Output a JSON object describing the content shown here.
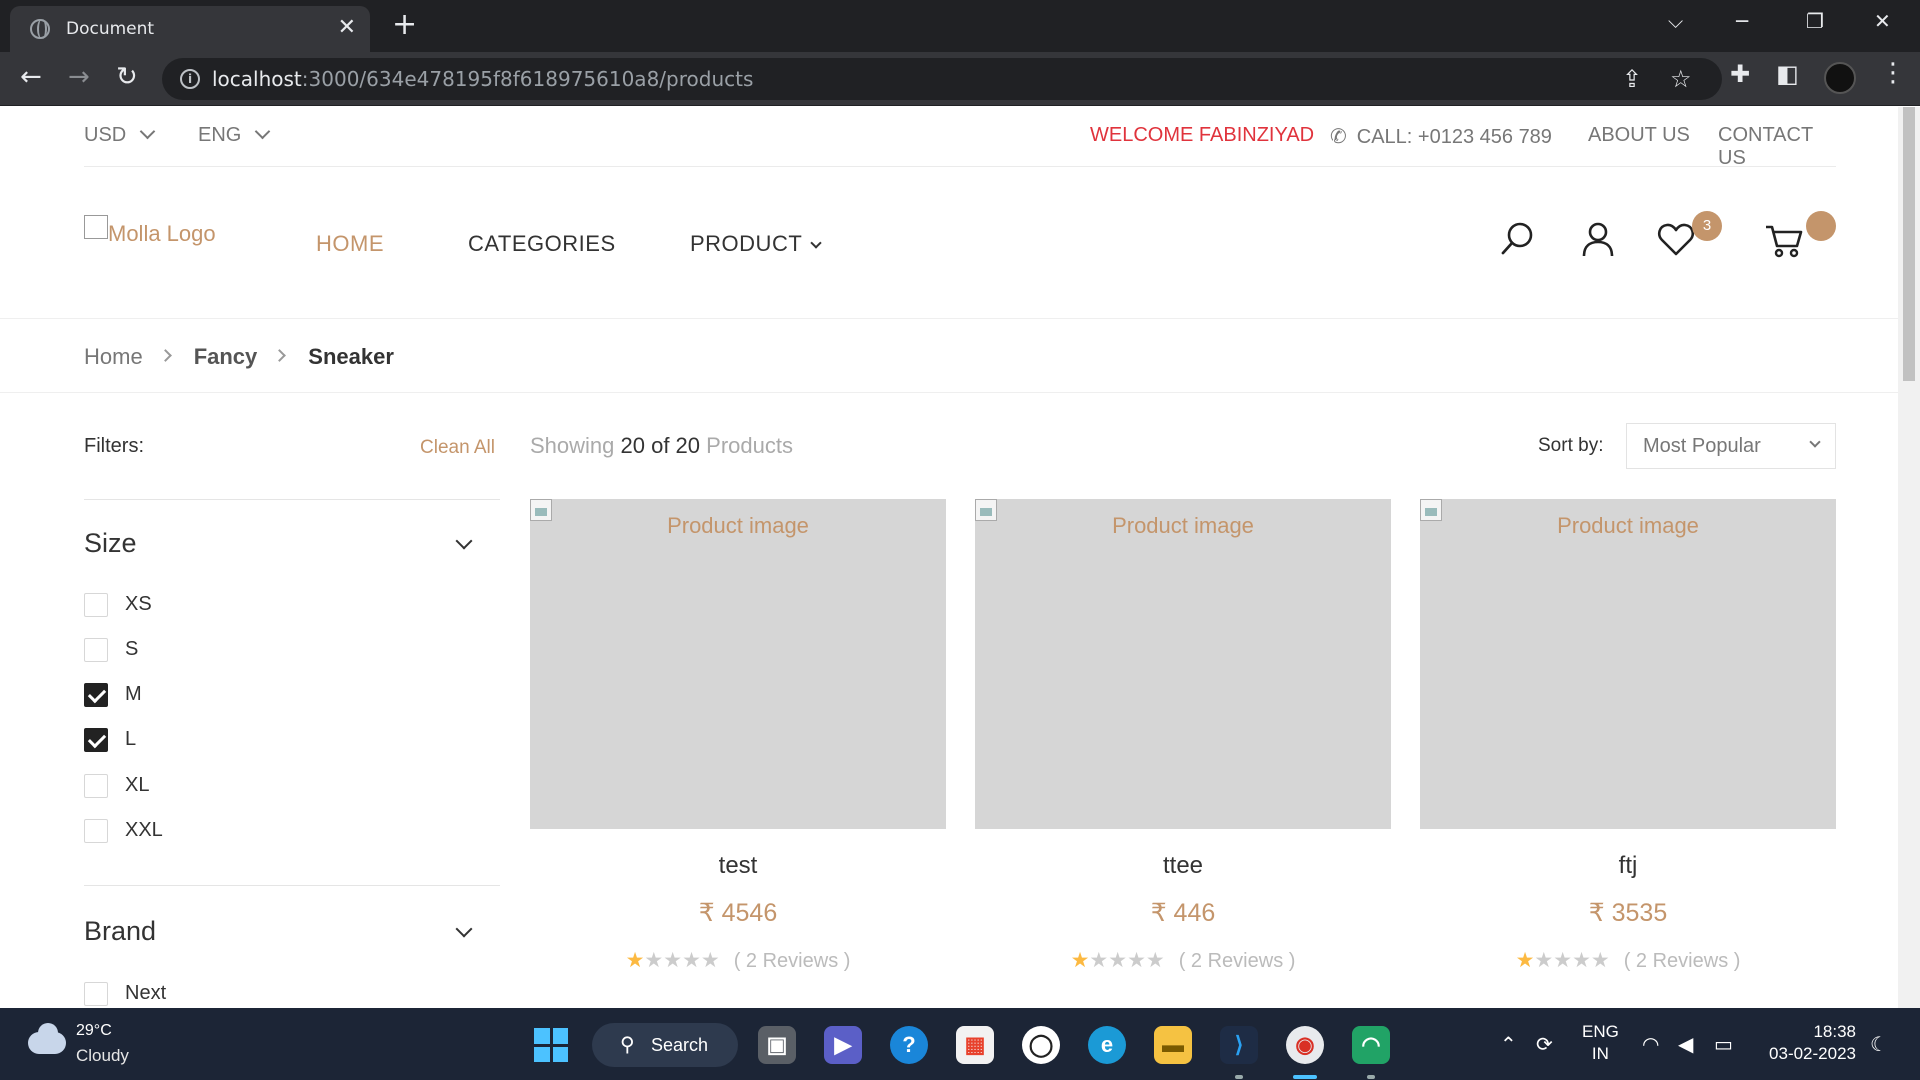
{
  "browser": {
    "tab_title": "Document",
    "url_host": "localhost",
    "url_path": ":3000/634e478195f8f618975610a8/products"
  },
  "topbar": {
    "currency": "USD",
    "language": "ENG",
    "welcome": "WELCOME FABINZIYAD",
    "call": "CALL: +0123 456 789",
    "about": "ABOUT US",
    "contact": "CONTACT US"
  },
  "header": {
    "logo_alt": "Molla Logo",
    "nav": {
      "home": "HOME",
      "categories": "CATEGORIES",
      "product": "PRODUCT"
    },
    "wishlist_count": "3",
    "cart_count": ""
  },
  "breadcrumb": {
    "home": "Home",
    "category": "Fancy",
    "current": "Sneaker"
  },
  "sidebar": {
    "filters_label": "Filters:",
    "clean_all": "Clean All",
    "size_title": "Size",
    "sizes": [
      {
        "label": "XS",
        "checked": false
      },
      {
        "label": "S",
        "checked": false
      },
      {
        "label": "M",
        "checked": true
      },
      {
        "label": "L",
        "checked": true
      },
      {
        "label": "XL",
        "checked": false
      },
      {
        "label": "XXL",
        "checked": false
      }
    ],
    "brand_title": "Brand",
    "brands": [
      {
        "label": "Next",
        "checked": false
      }
    ]
  },
  "listing": {
    "showing_prefix": "Showing",
    "showing_count": "20 of 20",
    "showing_suffix": "Products",
    "sort_label": "Sort by:",
    "sort_value": "Most Popular"
  },
  "products": [
    {
      "image_alt": "Product image",
      "name": "test",
      "price": "₹ 4546",
      "rating": 1,
      "reviews": "( 2 Reviews )"
    },
    {
      "image_alt": "Product image",
      "name": "ttee",
      "price": "₹ 446",
      "rating": 1,
      "reviews": "( 2 Reviews )"
    },
    {
      "image_alt": "Product image",
      "name": "ftj",
      "price": "₹ 3535",
      "rating": 1,
      "reviews": "( 2 Reviews )"
    }
  ],
  "taskbar": {
    "temperature": "29°C",
    "condition": "Cloudy",
    "search_label": "Search",
    "lang_line1": "ENG",
    "lang_line2": "IN",
    "time": "18:38",
    "date": "03-02-2023"
  },
  "colors": {
    "accent": "#c4956b",
    "welcome_red": "#e0333c",
    "star": "#fcb941",
    "taskbar": "#1c2536"
  }
}
